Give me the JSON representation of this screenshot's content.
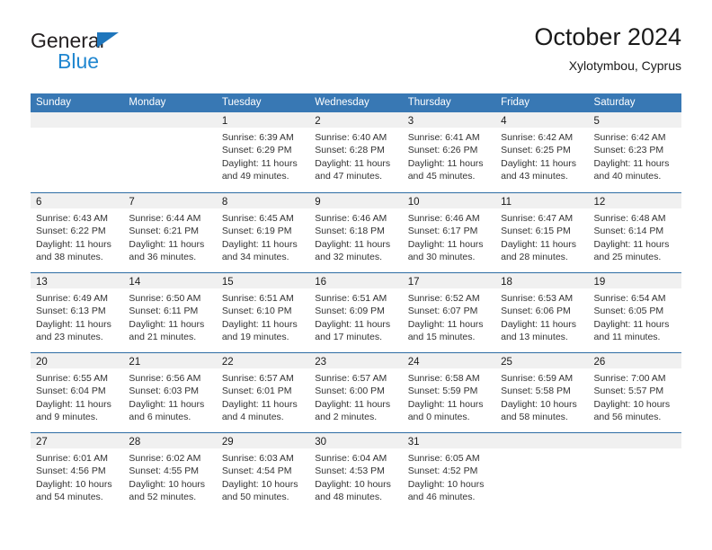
{
  "logo": {
    "word_one": "General",
    "word_two": "Blue",
    "triangle_color": "#1f76bc",
    "blue_text_color": "#1f86d0"
  },
  "header": {
    "title": "October 2024",
    "subtitle": "Xylotymbou, Cyprus"
  },
  "theme": {
    "header_row_bg": "#3878b4",
    "week_divider": "#2e6da4",
    "day_band_bg": "#f0f0f0",
    "text": "#333333"
  },
  "weekdays": [
    "Sunday",
    "Monday",
    "Tuesday",
    "Wednesday",
    "Thursday",
    "Friday",
    "Saturday"
  ],
  "weeks": [
    [
      {
        "date": "",
        "sunrise": "",
        "sunset": "",
        "daylight_line1": "",
        "daylight_line2": ""
      },
      {
        "date": "",
        "sunrise": "",
        "sunset": "",
        "daylight_line1": "",
        "daylight_line2": ""
      },
      {
        "date": "1",
        "sunrise": "Sunrise: 6:39 AM",
        "sunset": "Sunset: 6:29 PM",
        "daylight_line1": "Daylight: 11 hours",
        "daylight_line2": "and 49 minutes."
      },
      {
        "date": "2",
        "sunrise": "Sunrise: 6:40 AM",
        "sunset": "Sunset: 6:28 PM",
        "daylight_line1": "Daylight: 11 hours",
        "daylight_line2": "and 47 minutes."
      },
      {
        "date": "3",
        "sunrise": "Sunrise: 6:41 AM",
        "sunset": "Sunset: 6:26 PM",
        "daylight_line1": "Daylight: 11 hours",
        "daylight_line2": "and 45 minutes."
      },
      {
        "date": "4",
        "sunrise": "Sunrise: 6:42 AM",
        "sunset": "Sunset: 6:25 PM",
        "daylight_line1": "Daylight: 11 hours",
        "daylight_line2": "and 43 minutes."
      },
      {
        "date": "5",
        "sunrise": "Sunrise: 6:42 AM",
        "sunset": "Sunset: 6:23 PM",
        "daylight_line1": "Daylight: 11 hours",
        "daylight_line2": "and 40 minutes."
      }
    ],
    [
      {
        "date": "6",
        "sunrise": "Sunrise: 6:43 AM",
        "sunset": "Sunset: 6:22 PM",
        "daylight_line1": "Daylight: 11 hours",
        "daylight_line2": "and 38 minutes."
      },
      {
        "date": "7",
        "sunrise": "Sunrise: 6:44 AM",
        "sunset": "Sunset: 6:21 PM",
        "daylight_line1": "Daylight: 11 hours",
        "daylight_line2": "and 36 minutes."
      },
      {
        "date": "8",
        "sunrise": "Sunrise: 6:45 AM",
        "sunset": "Sunset: 6:19 PM",
        "daylight_line1": "Daylight: 11 hours",
        "daylight_line2": "and 34 minutes."
      },
      {
        "date": "9",
        "sunrise": "Sunrise: 6:46 AM",
        "sunset": "Sunset: 6:18 PM",
        "daylight_line1": "Daylight: 11 hours",
        "daylight_line2": "and 32 minutes."
      },
      {
        "date": "10",
        "sunrise": "Sunrise: 6:46 AM",
        "sunset": "Sunset: 6:17 PM",
        "daylight_line1": "Daylight: 11 hours",
        "daylight_line2": "and 30 minutes."
      },
      {
        "date": "11",
        "sunrise": "Sunrise: 6:47 AM",
        "sunset": "Sunset: 6:15 PM",
        "daylight_line1": "Daylight: 11 hours",
        "daylight_line2": "and 28 minutes."
      },
      {
        "date": "12",
        "sunrise": "Sunrise: 6:48 AM",
        "sunset": "Sunset: 6:14 PM",
        "daylight_line1": "Daylight: 11 hours",
        "daylight_line2": "and 25 minutes."
      }
    ],
    [
      {
        "date": "13",
        "sunrise": "Sunrise: 6:49 AM",
        "sunset": "Sunset: 6:13 PM",
        "daylight_line1": "Daylight: 11 hours",
        "daylight_line2": "and 23 minutes."
      },
      {
        "date": "14",
        "sunrise": "Sunrise: 6:50 AM",
        "sunset": "Sunset: 6:11 PM",
        "daylight_line1": "Daylight: 11 hours",
        "daylight_line2": "and 21 minutes."
      },
      {
        "date": "15",
        "sunrise": "Sunrise: 6:51 AM",
        "sunset": "Sunset: 6:10 PM",
        "daylight_line1": "Daylight: 11 hours",
        "daylight_line2": "and 19 minutes."
      },
      {
        "date": "16",
        "sunrise": "Sunrise: 6:51 AM",
        "sunset": "Sunset: 6:09 PM",
        "daylight_line1": "Daylight: 11 hours",
        "daylight_line2": "and 17 minutes."
      },
      {
        "date": "17",
        "sunrise": "Sunrise: 6:52 AM",
        "sunset": "Sunset: 6:07 PM",
        "daylight_line1": "Daylight: 11 hours",
        "daylight_line2": "and 15 minutes."
      },
      {
        "date": "18",
        "sunrise": "Sunrise: 6:53 AM",
        "sunset": "Sunset: 6:06 PM",
        "daylight_line1": "Daylight: 11 hours",
        "daylight_line2": "and 13 minutes."
      },
      {
        "date": "19",
        "sunrise": "Sunrise: 6:54 AM",
        "sunset": "Sunset: 6:05 PM",
        "daylight_line1": "Daylight: 11 hours",
        "daylight_line2": "and 11 minutes."
      }
    ],
    [
      {
        "date": "20",
        "sunrise": "Sunrise: 6:55 AM",
        "sunset": "Sunset: 6:04 PM",
        "daylight_line1": "Daylight: 11 hours",
        "daylight_line2": "and 9 minutes."
      },
      {
        "date": "21",
        "sunrise": "Sunrise: 6:56 AM",
        "sunset": "Sunset: 6:03 PM",
        "daylight_line1": "Daylight: 11 hours",
        "daylight_line2": "and 6 minutes."
      },
      {
        "date": "22",
        "sunrise": "Sunrise: 6:57 AM",
        "sunset": "Sunset: 6:01 PM",
        "daylight_line1": "Daylight: 11 hours",
        "daylight_line2": "and 4 minutes."
      },
      {
        "date": "23",
        "sunrise": "Sunrise: 6:57 AM",
        "sunset": "Sunset: 6:00 PM",
        "daylight_line1": "Daylight: 11 hours",
        "daylight_line2": "and 2 minutes."
      },
      {
        "date": "24",
        "sunrise": "Sunrise: 6:58 AM",
        "sunset": "Sunset: 5:59 PM",
        "daylight_line1": "Daylight: 11 hours",
        "daylight_line2": "and 0 minutes."
      },
      {
        "date": "25",
        "sunrise": "Sunrise: 6:59 AM",
        "sunset": "Sunset: 5:58 PM",
        "daylight_line1": "Daylight: 10 hours",
        "daylight_line2": "and 58 minutes."
      },
      {
        "date": "26",
        "sunrise": "Sunrise: 7:00 AM",
        "sunset": "Sunset: 5:57 PM",
        "daylight_line1": "Daylight: 10 hours",
        "daylight_line2": "and 56 minutes."
      }
    ],
    [
      {
        "date": "27",
        "sunrise": "Sunrise: 6:01 AM",
        "sunset": "Sunset: 4:56 PM",
        "daylight_line1": "Daylight: 10 hours",
        "daylight_line2": "and 54 minutes."
      },
      {
        "date": "28",
        "sunrise": "Sunrise: 6:02 AM",
        "sunset": "Sunset: 4:55 PM",
        "daylight_line1": "Daylight: 10 hours",
        "daylight_line2": "and 52 minutes."
      },
      {
        "date": "29",
        "sunrise": "Sunrise: 6:03 AM",
        "sunset": "Sunset: 4:54 PM",
        "daylight_line1": "Daylight: 10 hours",
        "daylight_line2": "and 50 minutes."
      },
      {
        "date": "30",
        "sunrise": "Sunrise: 6:04 AM",
        "sunset": "Sunset: 4:53 PM",
        "daylight_line1": "Daylight: 10 hours",
        "daylight_line2": "and 48 minutes."
      },
      {
        "date": "31",
        "sunrise": "Sunrise: 6:05 AM",
        "sunset": "Sunset: 4:52 PM",
        "daylight_line1": "Daylight: 10 hours",
        "daylight_line2": "and 46 minutes."
      },
      {
        "date": "",
        "sunrise": "",
        "sunset": "",
        "daylight_line1": "",
        "daylight_line2": ""
      },
      {
        "date": "",
        "sunrise": "",
        "sunset": "",
        "daylight_line1": "",
        "daylight_line2": ""
      }
    ]
  ]
}
